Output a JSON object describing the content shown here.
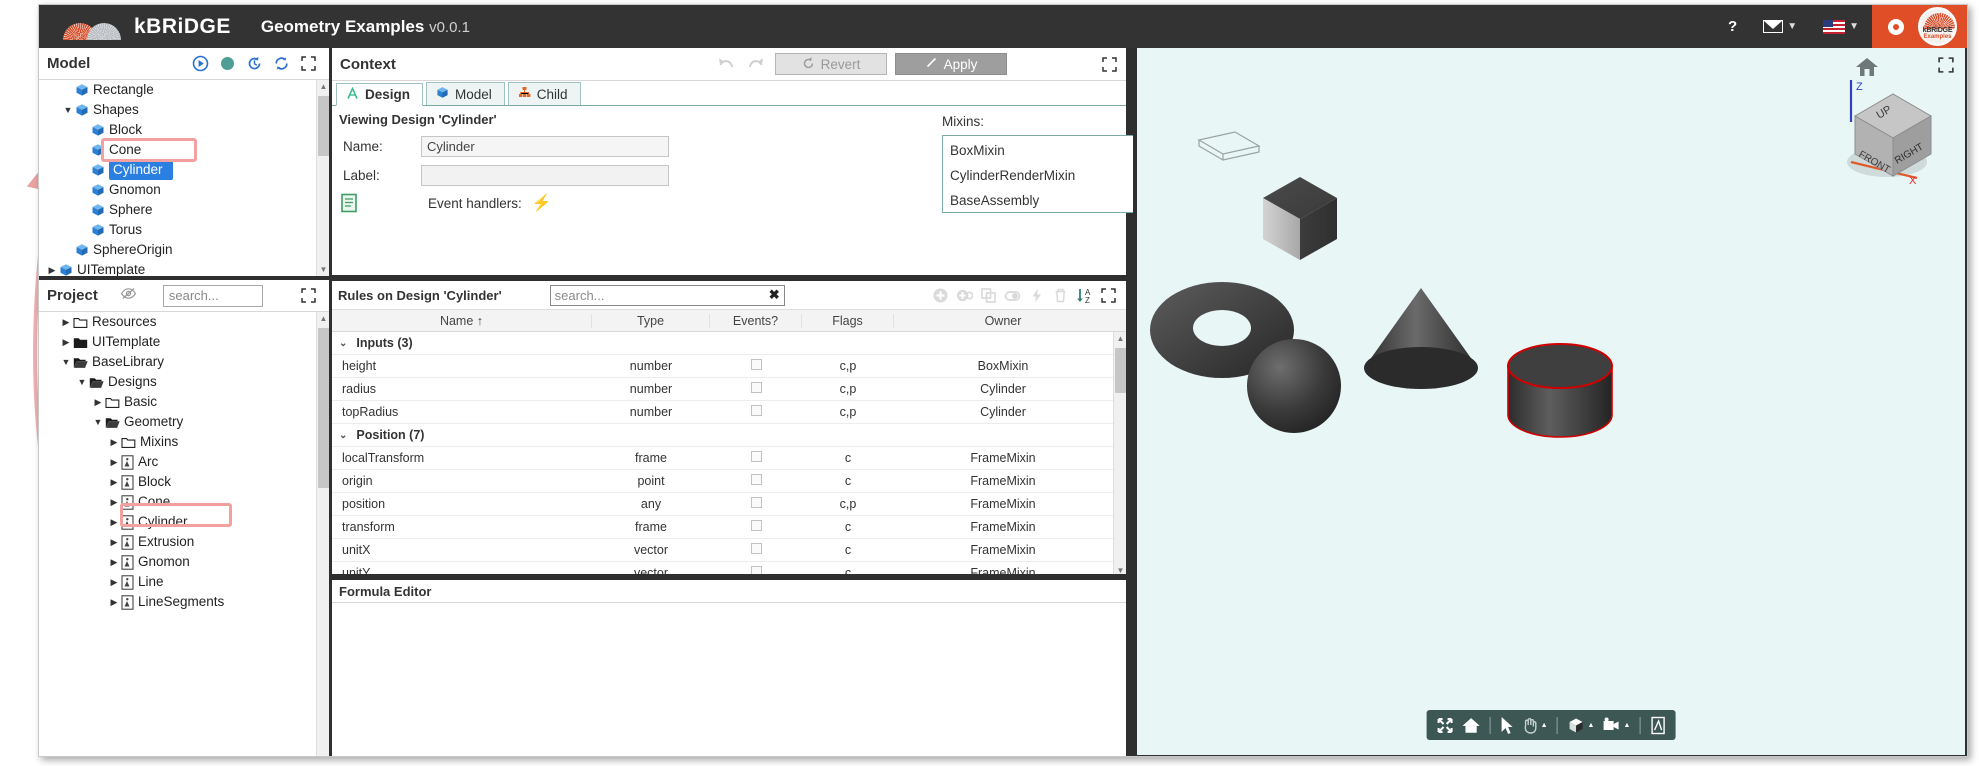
{
  "header": {
    "brand": "kBRiDGE",
    "brand_dot_letter": "i",
    "app_title": "Geometry Examples",
    "version": "v0.0.1",
    "help_icon": "question-mark-icon",
    "mail_icon": "envelope-icon",
    "locale_icon": "us-flag-icon",
    "settings_icon": "gear-icon",
    "avatar_line1": "kBRiDGE",
    "avatar_line2": "Examples",
    "accent_color": "#e04e28",
    "bar_color": "#333333"
  },
  "model_panel": {
    "title": "Model",
    "tools": [
      "play-icon",
      "status-dot-icon",
      "history-icon",
      "refresh-icon",
      "expand-icon"
    ],
    "tree": [
      {
        "label": "Rectangle",
        "indent": 1,
        "twisty": "",
        "icon": "cube-icon",
        "selected": false
      },
      {
        "label": "Shapes",
        "indent": 1,
        "twisty": "down",
        "icon": "cube-icon",
        "selected": false
      },
      {
        "label": "Block",
        "indent": 2,
        "twisty": "",
        "icon": "cube-icon",
        "selected": false
      },
      {
        "label": "Cone",
        "indent": 2,
        "twisty": "",
        "icon": "cube-icon",
        "selected": false
      },
      {
        "label": "Cylinder",
        "indent": 2,
        "twisty": "",
        "icon": "cube-icon",
        "selected": true
      },
      {
        "label": "Gnomon",
        "indent": 2,
        "twisty": "",
        "icon": "cube-icon",
        "selected": false
      },
      {
        "label": "Sphere",
        "indent": 2,
        "twisty": "",
        "icon": "cube-icon",
        "selected": false
      },
      {
        "label": "Torus",
        "indent": 2,
        "twisty": "",
        "icon": "cube-icon",
        "selected": false
      },
      {
        "label": "SphereOrigin",
        "indent": 1,
        "twisty": "",
        "icon": "cube-icon",
        "selected": false
      },
      {
        "label": "UITemplate",
        "indent": 0,
        "twisty": "right",
        "icon": "cube-icon",
        "selected": false
      }
    ]
  },
  "project_panel": {
    "title": "Project",
    "filter_icon": "eye-slash-icon",
    "search_value": "search...",
    "expand_icon": "expand-icon",
    "tree": [
      {
        "label": "Resources",
        "indent": 1,
        "twisty": "right",
        "icon": "folder-icon",
        "highlight": false
      },
      {
        "label": "UITemplate",
        "indent": 1,
        "twisty": "right",
        "icon": "folder-solid-icon",
        "highlight": false
      },
      {
        "label": "BaseLibrary",
        "indent": 1,
        "twisty": "down",
        "icon": "folder-open-icon",
        "highlight": false
      },
      {
        "label": "Designs",
        "indent": 2,
        "twisty": "down",
        "icon": "folder-open-icon",
        "highlight": false
      },
      {
        "label": "Basic",
        "indent": 3,
        "twisty": "right",
        "icon": "folder-icon",
        "highlight": false
      },
      {
        "label": "Geometry",
        "indent": 3,
        "twisty": "down",
        "icon": "folder-open-icon",
        "highlight": false
      },
      {
        "label": "Mixins",
        "indent": 4,
        "twisty": "right",
        "icon": "folder-icon",
        "highlight": false
      },
      {
        "label": "Arc",
        "indent": 4,
        "twisty": "right",
        "icon": "design-doc-icon",
        "highlight": false
      },
      {
        "label": "Block",
        "indent": 4,
        "twisty": "right",
        "icon": "design-doc-icon",
        "highlight": false
      },
      {
        "label": "Cone",
        "indent": 4,
        "twisty": "right",
        "icon": "design-doc-icon",
        "highlight": false
      },
      {
        "label": "Cylinder",
        "indent": 4,
        "twisty": "right",
        "icon": "design-doc-icon",
        "highlight": true
      },
      {
        "label": "Extrusion",
        "indent": 4,
        "twisty": "right",
        "icon": "design-doc-icon",
        "highlight": false
      },
      {
        "label": "Gnomon",
        "indent": 4,
        "twisty": "right",
        "icon": "design-doc-icon",
        "highlight": false
      },
      {
        "label": "Line",
        "indent": 4,
        "twisty": "right",
        "icon": "design-doc-icon",
        "highlight": false
      },
      {
        "label": "LineSegments",
        "indent": 4,
        "twisty": "right",
        "icon": "design-doc-icon",
        "highlight": false
      }
    ]
  },
  "context": {
    "title": "Context",
    "undo_icon": "undo-icon",
    "redo_icon": "redo-icon",
    "revert_label": "Revert",
    "apply_label": "Apply",
    "expand_icon": "expand-icon",
    "tabs": [
      {
        "label": "Design",
        "icon": "design-a-icon",
        "active": true
      },
      {
        "label": "Model",
        "icon": "cube-icon",
        "active": false
      },
      {
        "label": "Child",
        "icon": "hierarchy-icon",
        "active": false
      }
    ],
    "viewing_text": "Viewing Design 'Cylinder'",
    "name_label": "Name:",
    "name_value": "Cylinder",
    "label_label": "Label:",
    "label_value": "",
    "doc_icon": "green-document-icon",
    "event_handlers_label": "Event handlers:",
    "event_handlers_icon": "lightning-bolt-icon",
    "mixins_label": "Mixins:",
    "mixins": [
      "BoxMixin",
      "CylinderRenderMixin",
      "BaseAssembly"
    ]
  },
  "rules": {
    "title": "Rules on Design 'Cylinder'",
    "search_placeholder": "search...",
    "search_clear_icon": "clear-x-icon",
    "tools": [
      "add-icon",
      "add-copy-icon",
      "duplicate-icon",
      "toggle-icon",
      "lightning-bolt-icon",
      "trash-icon",
      "sort-az-icon",
      "expand-icon"
    ],
    "columns": [
      "Name",
      "Type",
      "Events?",
      "Flags",
      "Owner"
    ],
    "sort_column": "Name",
    "sort_direction": "asc",
    "groups": [
      {
        "label": "Inputs (3)",
        "rows": [
          {
            "name": "height",
            "type": "number",
            "events": false,
            "flags": "c,p",
            "owner": "BoxMixin"
          },
          {
            "name": "radius",
            "type": "number",
            "events": false,
            "flags": "c,p",
            "owner": "Cylinder"
          },
          {
            "name": "topRadius",
            "type": "number",
            "events": false,
            "flags": "c,p",
            "owner": "Cylinder"
          }
        ]
      },
      {
        "label": "Position (7)",
        "rows": [
          {
            "name": "localTransform",
            "type": "frame",
            "events": false,
            "flags": "c",
            "owner": "FrameMixin"
          },
          {
            "name": "origin",
            "type": "point",
            "events": false,
            "flags": "c",
            "owner": "FrameMixin"
          },
          {
            "name": "position",
            "type": "any",
            "events": false,
            "flags": "c,p",
            "owner": "FrameMixin"
          },
          {
            "name": "transform",
            "type": "frame",
            "events": false,
            "flags": "c",
            "owner": "FrameMixin"
          },
          {
            "name": "unitX",
            "type": "vector",
            "events": false,
            "flags": "c",
            "owner": "FrameMixin"
          },
          {
            "name": "unitY",
            "type": "vector",
            "events": false,
            "flags": "c",
            "owner": "FrameMixin"
          }
        ]
      }
    ]
  },
  "formula_editor": {
    "title": "Formula Editor",
    "content": ""
  },
  "viewport": {
    "background_color": "#e8f6f5",
    "expand_icon": "expand-icon",
    "home_icon": "home-icon",
    "viewcube": {
      "face_top": "UP",
      "face_left": "FRONT",
      "face_right": "RIGHT",
      "axis_z": "Z",
      "axis_x": "X"
    },
    "shapes": [
      {
        "name": "plate",
        "label": "flat-plate-wireframe"
      },
      {
        "name": "block",
        "label": "cube"
      },
      {
        "name": "torus",
        "label": "torus"
      },
      {
        "name": "sphere",
        "label": "sphere"
      },
      {
        "name": "cone",
        "label": "cone"
      },
      {
        "name": "cylinder",
        "label": "cylinder",
        "selected": true,
        "highlight_color": "#d00000"
      }
    ],
    "toolbar": [
      {
        "icon": "fit-view-icon",
        "caret": false
      },
      {
        "icon": "home-icon",
        "caret": false
      },
      {
        "icon": "sep",
        "caret": false
      },
      {
        "icon": "select-arrow-icon",
        "caret": false
      },
      {
        "icon": "pan-hand-icon",
        "caret": true
      },
      {
        "icon": "sep",
        "caret": false
      },
      {
        "icon": "render-cube-icon",
        "caret": true
      },
      {
        "icon": "camera-icon",
        "caret": true
      },
      {
        "icon": "sep",
        "caret": false
      },
      {
        "icon": "export-pdf-icon",
        "caret": false
      }
    ]
  },
  "annotations": {
    "highlight_color": "#f2a0a0",
    "callouts": [
      {
        "from": "project-tree-cylinder",
        "to": "model-tree-cylinder"
      },
      {
        "from": "context-name-field",
        "to": "viewport-cylinder"
      }
    ]
  }
}
